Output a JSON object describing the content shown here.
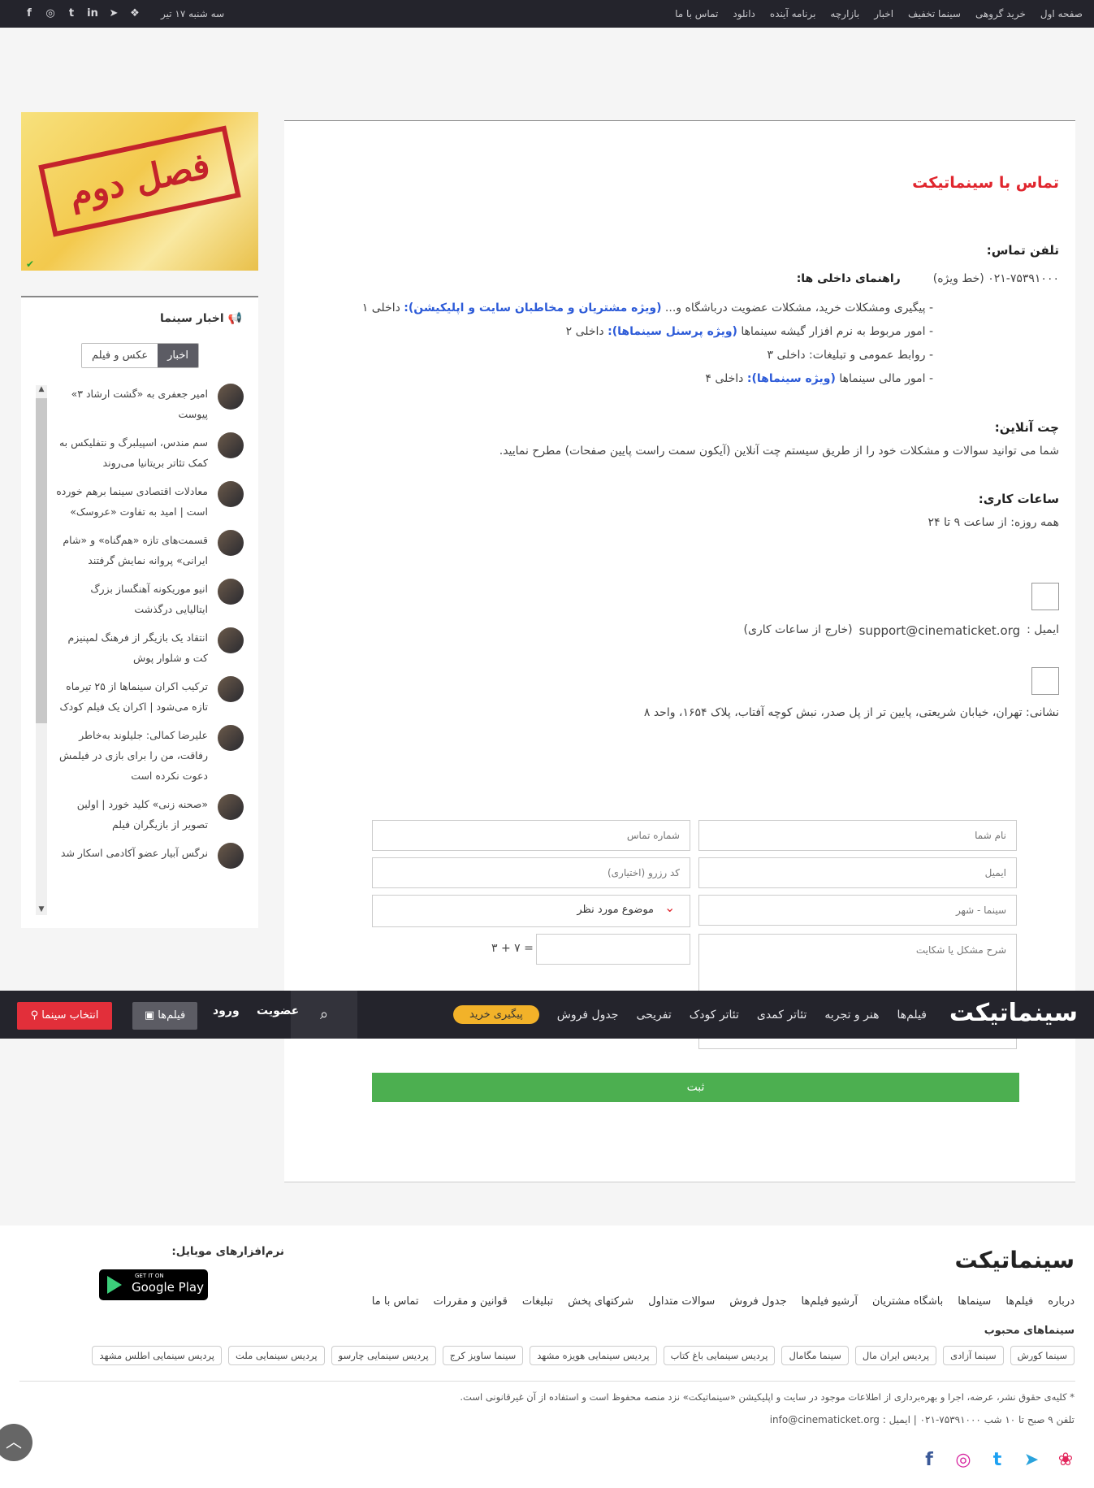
{
  "topbar": {
    "nav": [
      "صفحه اول",
      "خرید گروهی",
      "سینما تخفیف",
      "اخبار",
      "بازارچه",
      "برنامه آینده",
      "دانلود",
      "تماس با ما"
    ],
    "date": "سه شنبه ۱۷ تیر"
  },
  "contact": {
    "title": "تماس با سینماتیکت",
    "phone_label": "تلفن تماس:",
    "phone_value": "۰۲۱-۷۵۳۹۱۰۰۰ (خط ویژه)",
    "guide_label": "راهنمای داخلی ها:",
    "line1_a": "- پیگیری ومشکلات خرید، مشکلات عضویت درباشگاه و... ",
    "line1_b": "(ویژه مشتریان و مخاطبان سایت و اپلیکیشن):",
    "line1_c": " داخلی ۱",
    "line2_a": "- امور مربوط به نرم افزار گیشه سینماها ",
    "line2_b": "(ویژه پرسنل سینماها):",
    "line2_c": " داخلی ۲",
    "line3": "- روابط عمومی و تبلیغات: داخلی ۳",
    "line4_a": "- امور مالی سینماها ",
    "line4_b": "(ویژه سینماها):",
    "line4_c": " داخلی ۴",
    "chat_label": "چت آنلاین:",
    "chat_text": "شما می توانید سوالات و مشکلات خود را از طریق سیستم چت آنلاین (آیکون سمت راست پایین صفحات) مطرح نمایید.",
    "hours_label": "ساعات کاری:",
    "hours_text": "همه روزه: از ساعت ۹ تا ۲۴",
    "email_label": "ایمیل :",
    "email_value": "support@cinematicket.org",
    "email_note": "(خارج از ساعات کاری)",
    "address": "نشانی: تهران، خیابان شریعتی، پایین تر از پل صدر، نبش کوچه آفتاب، پلاک ۱۶۵۴، واحد ۸"
  },
  "form": {
    "name_ph": "نام شما",
    "phone_ph": "شماره تماس",
    "email_ph": "ایمیل",
    "code_ph": "کد رزرو (اختیاری)",
    "cinema_ph": "سینما - شهر",
    "subject": "موضوع مورد نظر",
    "desc_ph": "شرح مشکل یا شکایت",
    "captcha": "= ۷ + ۳",
    "submit": "ثبت"
  },
  "ad": {
    "text": "فصل دوم"
  },
  "news": {
    "title": "اخبار سینما",
    "tab_news": "اخبار",
    "tab_photo": "عکس و فیلم",
    "items": [
      "امیر جعفری به «گشت ارشاد ۳» پیوست",
      "سم مندس، اسپیلبرگ و نتفلیکس به کمک تئاتر بریتانیا می‌روند",
      "معادلات اقتصادی سینما برهم خورده است | امید به تفاوت «عروسک»",
      "قسمت‌های تازه «هم‌گناه» و «شام ایرانی» پروانه نمایش گرفتند",
      "انیو موریکونه آهنگساز بزرگ ایتالیایی درگذشت",
      "انتقاد یک بازیگر از فرهنگ لمپنیزم کت و شلوار پوش",
      "ترکیب اکران سینماها از ۲۵ تیرماه تازه می‌شود | اکران یک فیلم کودک",
      "علیرضا کمالی: جلیلوند به‌خاطر رفاقت، من را برای بازی در فیلمش دعوت نکرده است",
      "«صحنه زنی» کلید خورد | اولین تصویر از بازیگران فیلم",
      "نرگس آبیار عضو آکادمی اسکار شد"
    ]
  },
  "navbar": {
    "logo": "سینماتیکت",
    "links": [
      "فیلم‌ها",
      "هنر و تجربه",
      "تئاتر کمدی",
      "تئاتر کودک",
      "تفریحی",
      "جدول فروش"
    ],
    "track": "پیگیری خرید",
    "signup": "عضویت",
    "login": "ورود",
    "films": "فیلم‌ها",
    "select_cinema": "انتخاب سینما"
  },
  "footer": {
    "logo": "سینماتیکت",
    "mobile_label": "نرم‌افزارهای موبایل:",
    "gplay_small": "GET IT ON",
    "gplay_big": "Google Play",
    "links": [
      "درباره",
      "فیلم‌ها",
      "سینماها",
      "باشگاه مشتریان",
      "آرشیو فیلم‌ها",
      "جدول فروش",
      "سوالات متداول",
      "شرکتهای پخش",
      "تبلیغات",
      "قوانین و مقررات",
      "تماس با ما"
    ],
    "popular_label": "سینماهای محبوب",
    "cinemas": [
      "سینما کورش",
      "سینما آزادی",
      "پردیس ایران مال",
      "سینما مگامال",
      "پردیس سینمایی باغ کتاب",
      "پردیس سینمایی هویزه مشهد",
      "سینما ساویز کرج",
      "پردیس سینمایی چارسو",
      "پردیس سینمایی ملت",
      "پردیس سینمایی اطلس مشهد"
    ],
    "copyright": "* کلیه‌ی حقوق نشر، عرضه، اجرا و بهره‌برداری از اطلاعات موجود در سایت و اپلیکیشن «سینماتیکت» نزد منصه محفوظ است و استفاده از آن غیرقانونی است.",
    "contact_line": "تلفن ۹ صبح تا ۱۰ شب ۷۵۳۹۱۰۰۰-۰۲۱ | ایمیل : info@cinematicket.org"
  },
  "colors": {
    "accent": "#e0262e",
    "link": "#2d5bd8",
    "submit": "#4caf50",
    "topbar": "#24242c",
    "track": "#f2b229"
  }
}
